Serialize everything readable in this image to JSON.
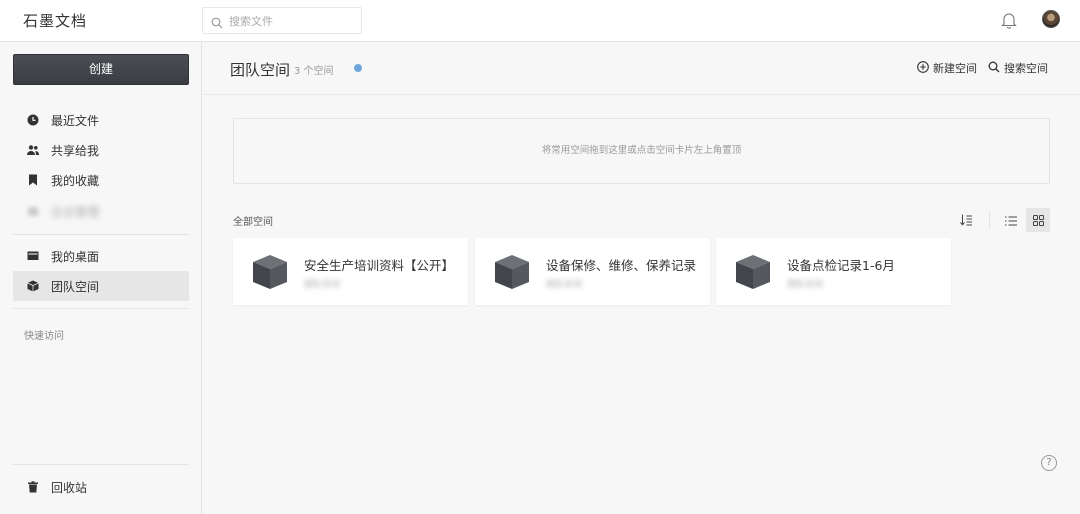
{
  "app": {
    "title": "石墨文档"
  },
  "topbar": {
    "search_placeholder": "搜索文件",
    "search_icon": "search-icon",
    "bell_icon": "bell-icon",
    "avatar_icon": "user-avatar"
  },
  "sidebar": {
    "create_label": "创建",
    "items": [
      {
        "label": "最近文件",
        "icon": "clock-icon"
      },
      {
        "label": "共享给我",
        "icon": "people-icon"
      },
      {
        "label": "我的收藏",
        "icon": "bookmark-icon"
      },
      {
        "label": "企业管理",
        "icon": "building-icon"
      },
      {
        "label": "我的桌面",
        "icon": "desktop-icon"
      },
      {
        "label": "团队空间",
        "icon": "cube-icon",
        "active": true
      }
    ],
    "quick_access_label": "快速访问",
    "trash_label": "回收站"
  },
  "main": {
    "title": "团队空间",
    "count": "3 个空间",
    "new_space_label": "新建空间",
    "search_space_label": "搜索空间",
    "pin_hint": "将常用空间拖到这里或点击空间卡片左上角置顶",
    "section_label": "全部空间",
    "spaces": [
      {
        "name": "安全生产培训资料【公开】",
        "sub": "团队空间"
      },
      {
        "name": "设备保修、维修、保养记录",
        "sub": "团队空间"
      },
      {
        "name": "设备点检记录1-6月",
        "sub": "团队空间"
      }
    ]
  },
  "colors": {
    "accent_dot": "#6ea6dc",
    "create_button": "#3f4247",
    "active_item_bg": "#e6e6e6"
  },
  "help_label": "?"
}
